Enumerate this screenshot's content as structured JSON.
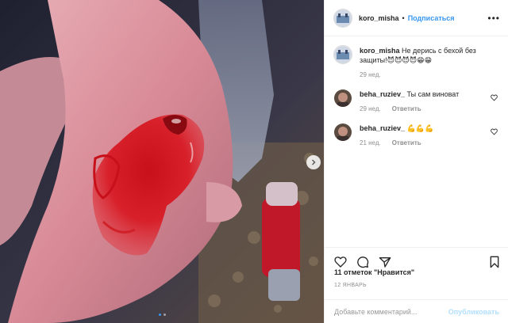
{
  "header": {
    "username": "koro_misha",
    "separator": "•",
    "follow_label": "Подписаться",
    "more_icon": "more-horizontal-icon"
  },
  "caption": {
    "username": "koro_misha",
    "text": "Не дерись с бехой без защиты!😈😈😈😈😁😁",
    "time": "29 нед."
  },
  "comments": [
    {
      "username": "beha_ruziev_",
      "text": "Ты сам виноват",
      "time": "29 нед.",
      "reply_label": "Ответить"
    },
    {
      "username": "beha_ruziev_",
      "text": "💪💪💪",
      "time": "21 нед.",
      "reply_label": "Ответить"
    }
  ],
  "actions": {
    "like_icon": "heart-icon",
    "comment_icon": "comment-icon",
    "share_icon": "share-icon",
    "save_icon": "bookmark-icon"
  },
  "likes_text": "11 отметок \"Нравится\"",
  "date_text": "12 ЯНВАРЬ",
  "add_comment": {
    "placeholder": "Добавьте комментарий...",
    "publish_label": "Опубликовать"
  },
  "carousel": {
    "current": 1,
    "total": 2,
    "next_icon": "chevron-right-icon"
  },
  "colors": {
    "accent": "#3897f0",
    "publish_disabled": "#b2dffc",
    "muted": "#8e8e8e"
  }
}
